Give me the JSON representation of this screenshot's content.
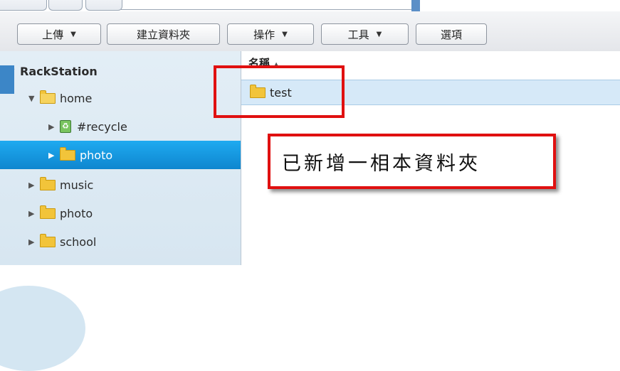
{
  "toolbar": {
    "upload_label": "上傳",
    "new_folder_label": "建立資料夾",
    "action_label": "操作",
    "tools_label": "工具",
    "options_label": "選項"
  },
  "tree": {
    "root": "RackStation",
    "items": [
      {
        "label": "home",
        "icon": "folder-open-icon"
      },
      {
        "label": "#recycle",
        "icon": "recycle-bin-icon"
      },
      {
        "label": "photo",
        "icon": "folder-icon",
        "selected": true
      },
      {
        "label": "music",
        "icon": "folder-icon"
      },
      {
        "label": "photo",
        "icon": "folder-icon"
      },
      {
        "label": "school",
        "icon": "folder-icon"
      }
    ]
  },
  "content": {
    "column_header": "名稱",
    "files": [
      {
        "name": "test",
        "icon": "folder-icon"
      }
    ]
  },
  "annotation": {
    "callout_text": "已新增一相本資料夾",
    "color": "#e01010"
  },
  "colors": {
    "selection": "#1faaf0",
    "tree_bg": "#dbe9f3"
  }
}
